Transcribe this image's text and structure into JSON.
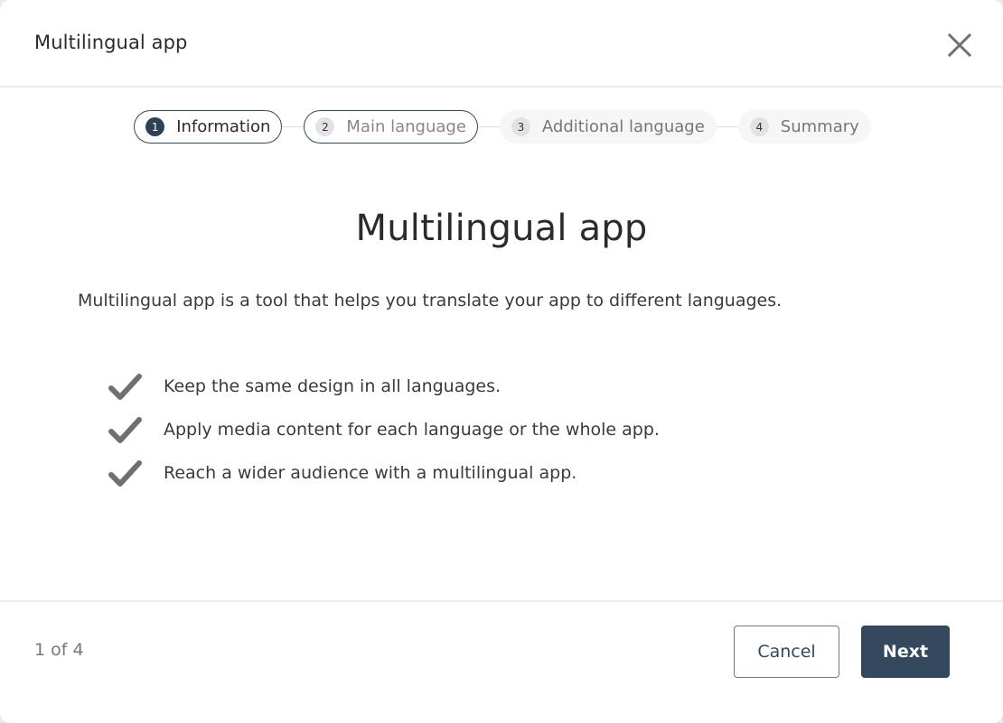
{
  "dialog": {
    "title": "Multilingual app",
    "close_icon": "close-icon"
  },
  "stepper": {
    "steps": [
      {
        "number": "1",
        "label": "Information",
        "state": "active"
      },
      {
        "number": "2",
        "label": "Main language",
        "state": "visited"
      },
      {
        "number": "3",
        "label": "Additional language",
        "state": "pending"
      },
      {
        "number": "4",
        "label": "Summary",
        "state": "pending"
      }
    ]
  },
  "content": {
    "heading": "Multilingual app",
    "intro": "Multilingual app is a tool that helps you translate your app to different languages.",
    "features": [
      {
        "icon": "checkmark-icon",
        "text": "Keep the same design in all languages."
      },
      {
        "icon": "checkmark-icon",
        "text": "Apply media content for each language or the whole app."
      },
      {
        "icon": "checkmark-icon",
        "text": "Reach a wider audience with a multilingual app."
      }
    ]
  },
  "footer": {
    "page_indicator": "1 of 4",
    "cancel_label": "Cancel",
    "next_label": "Next"
  },
  "colors": {
    "primary": "#34495e",
    "step_active_badge": "#2d4157",
    "checkmark": "#707070"
  }
}
